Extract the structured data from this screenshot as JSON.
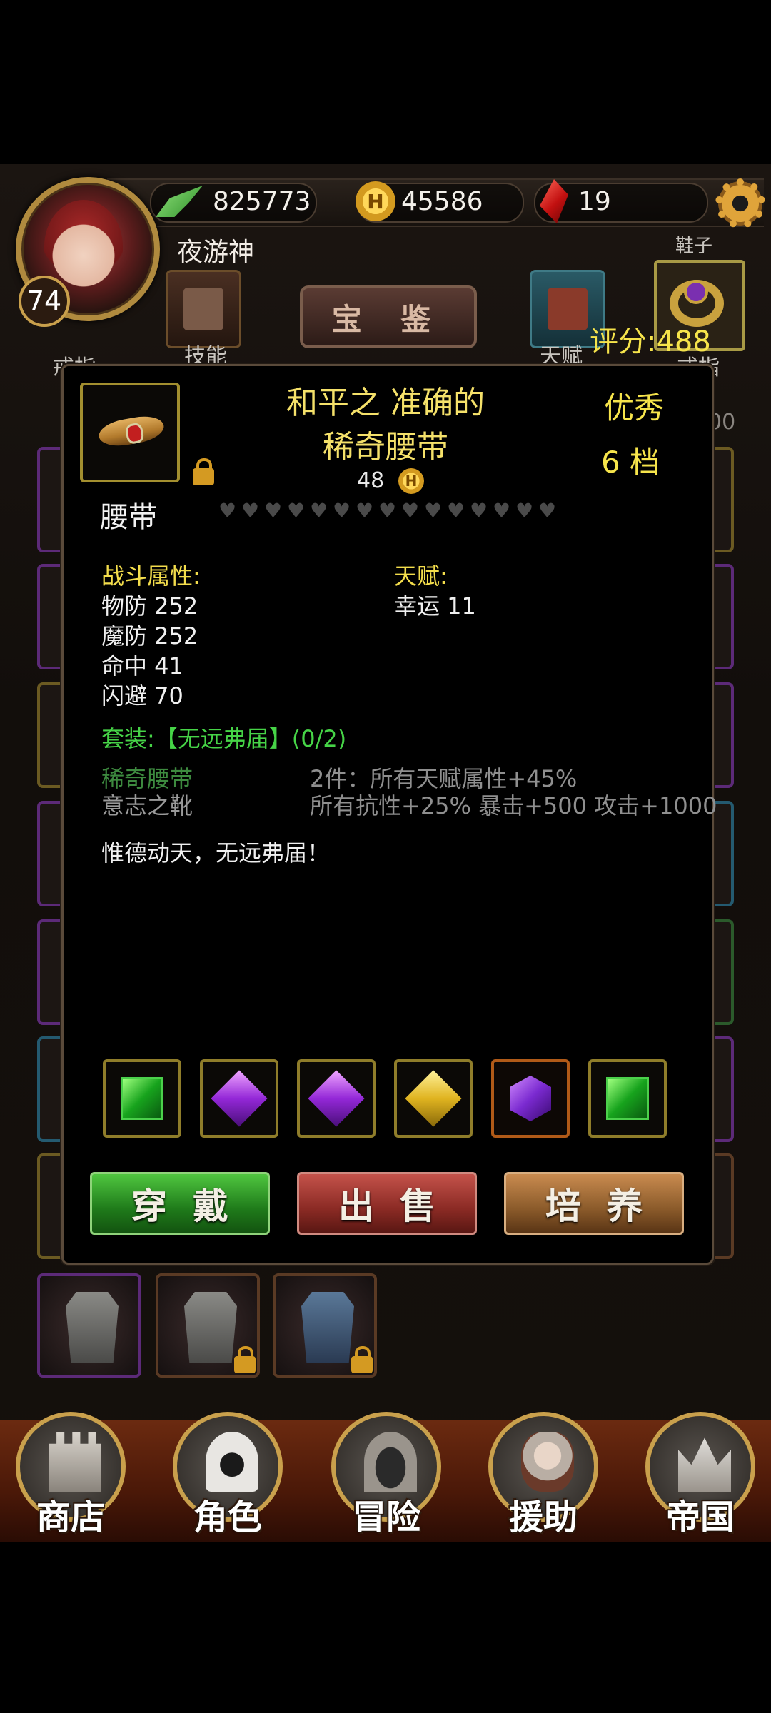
{
  "hud": {
    "exp": "825773",
    "gold": "45586",
    "gems": "19",
    "level": "74",
    "nickname": "夜游神"
  },
  "top_menu": {
    "treasure_label": "宝 鉴",
    "skill_label": "技能",
    "talent_label": "天赋",
    "ring_label_left": "戒指",
    "ring_label_right": "戒指",
    "shoes_label": "鞋子",
    "score": "评分:488",
    "right_count": "00"
  },
  "item": {
    "title_line1": "和平之 准确的",
    "title_line2": "稀奇腰带",
    "quality": "优秀",
    "tier": "6  档",
    "price": "48",
    "coin_glyph": "H",
    "type": "腰带",
    "heart_count": 15,
    "combat_title": "战斗属性:",
    "combat_stats": [
      "物防 252",
      "魔防 252",
      "命中 41",
      "闪避 70"
    ],
    "talent_title": "天赋:",
    "talent_stats": [
      "幸运 11"
    ],
    "set_title": "套装:【无远弗届】(0/2)",
    "set_pieces": [
      "稀奇腰带",
      "意志之靴"
    ],
    "set_effects": [
      "2件：所有天赋属性+45%",
      "所有抗性+25% 暴击+500 攻击+1000"
    ],
    "flavor": "惟德动天，无远弗届！"
  },
  "gems": [
    "green-square-gem",
    "purple-diamond-gem",
    "purple-diamond-gem",
    "yellow-diamond-gem",
    "purple-hex-gem",
    "green-square-gem"
  ],
  "actions": {
    "equip": "穿戴",
    "sell": "出售",
    "train": "培养"
  },
  "bottom_nav": [
    {
      "label": "商店",
      "icon": "castle-icon"
    },
    {
      "label": "角色",
      "icon": "hooded-figure-icon"
    },
    {
      "label": "冒险",
      "icon": "dungeon-gate-icon"
    },
    {
      "label": "援助",
      "icon": "helper-portrait-icon"
    },
    {
      "label": "帝国",
      "icon": "crown-icon"
    }
  ],
  "colors": {
    "gold_text": "#f6e44b",
    "set_green": "#46d447",
    "set_dim_green": "#3d8a3f",
    "muted_gray": "#8f8f8f"
  }
}
